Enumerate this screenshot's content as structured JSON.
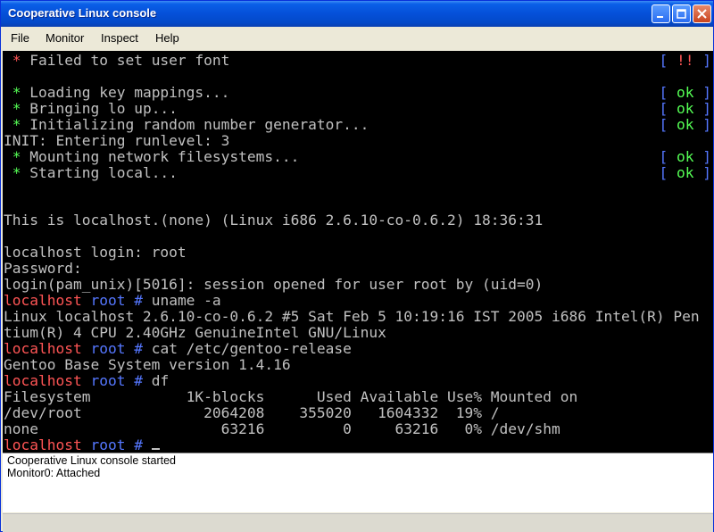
{
  "window": {
    "title": "Cooperative Linux console"
  },
  "menu": {
    "items": [
      "File",
      "Monitor",
      "Inspect",
      "Help"
    ]
  },
  "console": {
    "boot": [
      {
        "text": "Failed to set user font",
        "status_open": "[",
        "status": "!!",
        "status_close": "]"
      },
      {
        "text": "Loading key mappings...",
        "status_open": "[",
        "status": "ok",
        "status_close": "]"
      },
      {
        "text": "Bringing lo up...",
        "status_open": "[",
        "status": "ok",
        "status_close": "]"
      },
      {
        "text": "Initializing random number generator...",
        "status_open": "[",
        "status": "ok",
        "status_close": "]"
      },
      {
        "text": "Mounting network filesystems...",
        "status_open": "[",
        "status": "ok",
        "status_close": "]"
      },
      {
        "text": "Starting local...",
        "status_open": "[",
        "status": "ok",
        "status_close": "]"
      }
    ],
    "bullet": "*",
    "init_line": "INIT: Entering runlevel: 3",
    "banner": "This is localhost.(none) (Linux i686 2.6.10-co-0.6.2) 18:36:31",
    "login_line": "localhost login: root",
    "password_line": "Password:",
    "pam_line": "login(pam_unix)[5016]: session opened for user root by (uid=0)",
    "prompt": {
      "host": "localhost",
      "dir": "root",
      "symbol": "#"
    },
    "cmd1": "uname -a",
    "uname_out1": "Linux localhost 2.6.10-co-0.6.2 #5 Sat Feb 5 10:19:16 IST 2005 i686 Intel(R) Pen",
    "uname_out2": "tium(R) 4 CPU 2.40GHz GenuineIntel GNU/Linux",
    "cmd2": "cat /etc/gentoo-release",
    "gentoo_out": "Gentoo Base System version 1.4.16",
    "cmd3": "df",
    "df_header": "Filesystem           1K-blocks      Used Available Use% Mounted on",
    "df_row1": "/dev/root              2064208    355020   1604332  19% /",
    "df_row2": "none                     63216         0     63216   0% /dev/shm"
  },
  "log": {
    "lines": [
      "Cooperative Linux console started",
      "Monitor0: Attached"
    ]
  },
  "colors": {
    "ok": "#55ff55",
    "error": "#ff5555",
    "bracket": "#5577ff",
    "prompt_host": "#ff5555",
    "prompt_dir": "#5577ff"
  }
}
